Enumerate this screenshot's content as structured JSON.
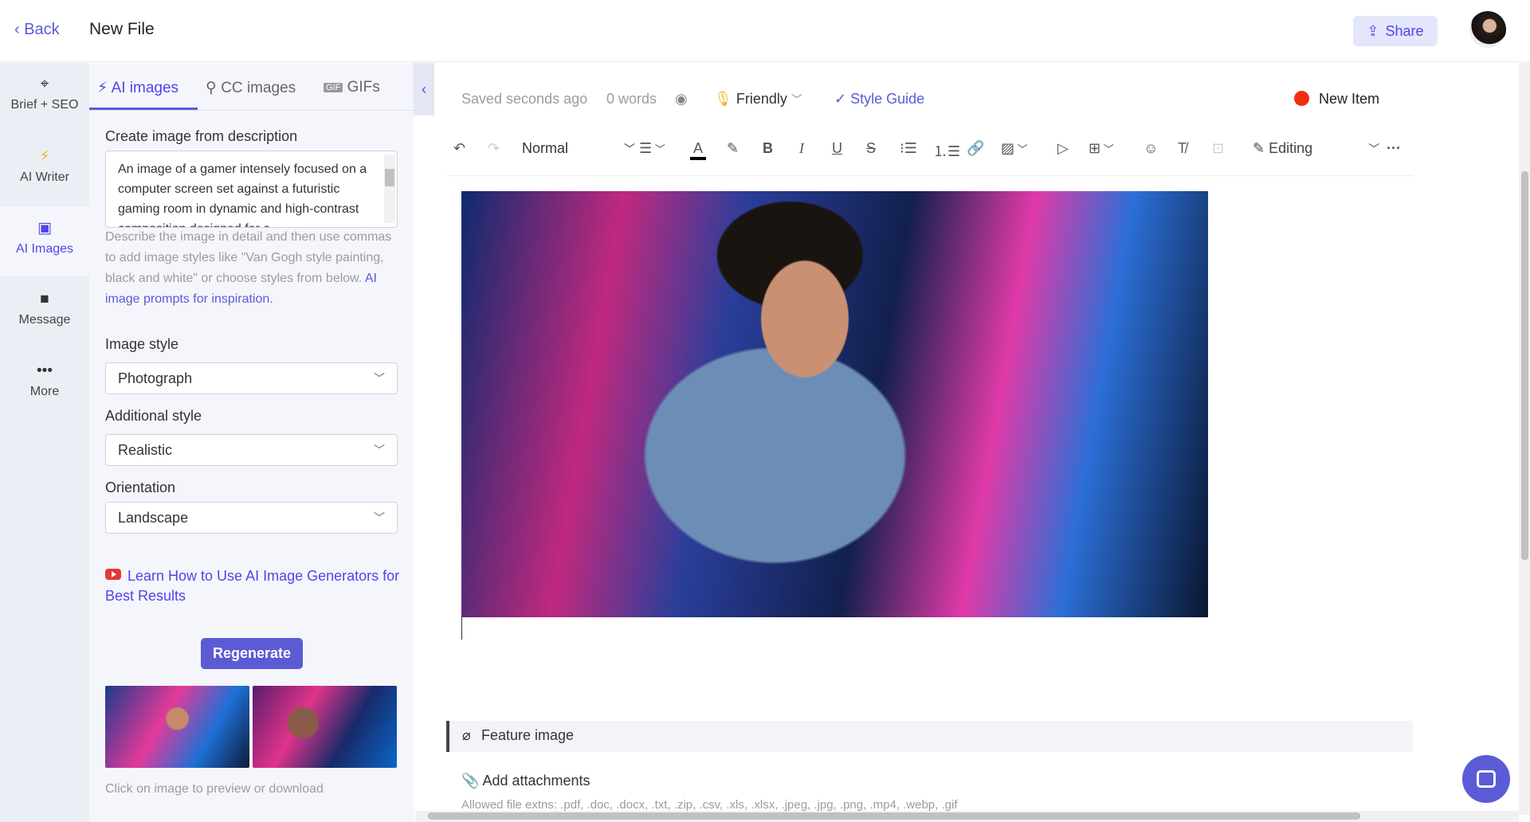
{
  "header": {
    "back": "Back",
    "title": "New File",
    "share": "Share"
  },
  "rail": [
    {
      "icon": "crosshair-icon",
      "label": "Brief + SEO"
    },
    {
      "icon": "bolt-icon",
      "label": "AI Writer"
    },
    {
      "icon": "image-icon",
      "label": "AI Images"
    },
    {
      "icon": "message-icon",
      "label": "Message"
    },
    {
      "icon": "more-icon",
      "label": "More"
    }
  ],
  "panel": {
    "tabs": [
      "AI images",
      "CC images",
      "GIFs"
    ],
    "desc_label": "Create image from description",
    "desc_value": "An image of a gamer intensely focused on a computer screen set against a futuristic gaming room in dynamic and high-contrast composition designed for a",
    "hint": "Describe the image in detail and then use commas to add image styles like \"Van Gogh style painting, black and white\" or choose styles from below.",
    "hint_link": "AI image prompts for inspiration.",
    "image_style_label": "Image style",
    "image_style": "Photograph",
    "additional_style_label": "Additional style",
    "additional_style": "Realistic",
    "orientation_label": "Orientation",
    "orientation": "Landscape",
    "learn_link": "Learn How to Use AI Image Generators for Best Results",
    "regenerate": "Regenerate",
    "caption": "Click on image to preview or download"
  },
  "editor": {
    "saved": "Saved seconds ago",
    "words": "0 words",
    "tone": "Friendly",
    "style_guide": "Style Guide",
    "status": "New Item",
    "status_color": "#f02e0c",
    "block_format": "Normal",
    "mode": "Editing",
    "feature_image": "Feature image",
    "add_attachments": "Add attachments",
    "allowed": "Allowed file extns: .pdf, .doc, .docx, .txt, .zip, .csv, .xls, .xlsx, .jpeg, .jpg, .png, .mp4, .webp, .gif"
  },
  "colors": {
    "accent": "#5b5bd6"
  }
}
